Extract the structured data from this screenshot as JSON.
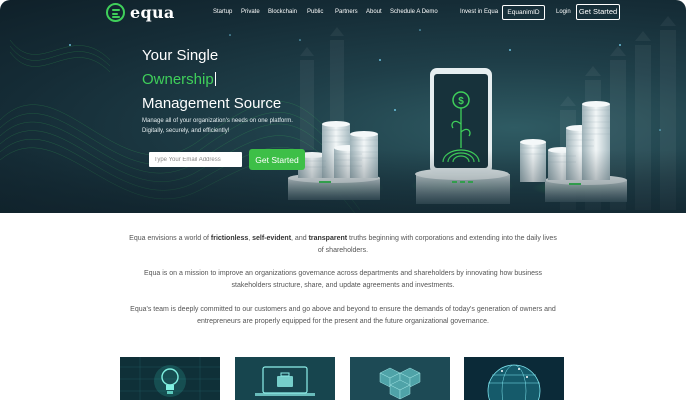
{
  "brand": {
    "name": "equa"
  },
  "nav": {
    "links": [
      "Startup",
      "Private",
      "Blockchain",
      "Public",
      "Partners",
      "About",
      "Schedule A Demo",
      "Invest in Equa"
    ],
    "equanim_button": "EquanimID",
    "login": "Login",
    "get_started": "Get Started"
  },
  "hero": {
    "line1": "Your Single",
    "line2": "Ownership",
    "line3": "Management Source",
    "subtitle_1": "Manage all of your organization's needs on one platform.",
    "subtitle_2": "Digitally, securely, and efficiently!",
    "email_placeholder": "Type Your Email Address",
    "cta": "Get Started",
    "dollar_symbol": "$"
  },
  "mission": {
    "p1_a": "Equa envisions a world of ",
    "p1_b": "frictionless",
    "p1_c": ", ",
    "p1_d": "self-evident",
    "p1_e": ", and ",
    "p1_f": "transparent",
    "p1_g": " truths beginning with corporations and extending into the daily lives",
    "p1_h": "of shareholders.",
    "p2_a": "Equa is on a mission to improve an organizations governance across departments and shareholders by innovating how business",
    "p2_b": "stakeholders structure, share, and update agreements and investments.",
    "p3_a": "Equa's team is deeply committed to our customers and go above and beyond to ensure the demands of today's generation of owners and",
    "p3_b": "entrepreneurs are properly equipped for the present and the future organizational governance."
  },
  "cards": [
    {
      "icon": "lightbulb-icon"
    },
    {
      "icon": "laptop-briefcase-icon"
    },
    {
      "icon": "blockchain-cubes-icon"
    },
    {
      "icon": "globe-icon"
    }
  ],
  "colors": {
    "brand_green": "#3fcf5a",
    "cta_green": "#3dbf47",
    "hero_dark": "#152c36",
    "text_gray": "#555555"
  }
}
